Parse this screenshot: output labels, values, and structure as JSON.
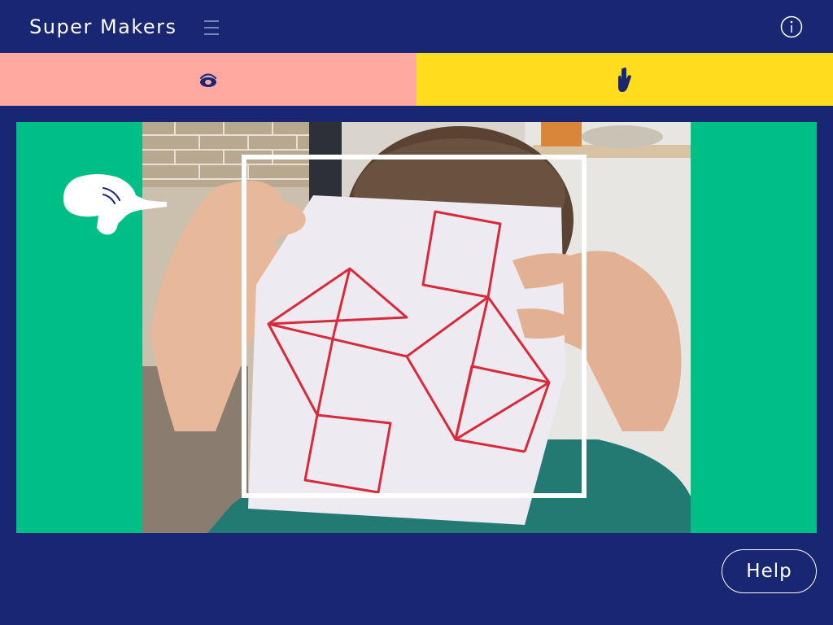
{
  "header": {
    "title": "Super Makers",
    "menu_icon": "hamburger-icon",
    "info_icon": "info-icon"
  },
  "tabs": [
    {
      "icon": "eye-icon",
      "color": "#ffa9a0"
    },
    {
      "icon": "hand-icon",
      "color": "#ffdc1e"
    }
  ],
  "stage": {
    "background": "#00bf86",
    "pointer_icon": "pointing-hand-icon",
    "image": "child-holding-paper-with-red-geometric-drawing"
  },
  "help_button": {
    "label": "Help"
  },
  "colors": {
    "navy": "#192672",
    "pink": "#ffa9a0",
    "yellow": "#ffdc1e",
    "green": "#00bf86",
    "white": "#ffffff",
    "red": "#d82b3a"
  }
}
